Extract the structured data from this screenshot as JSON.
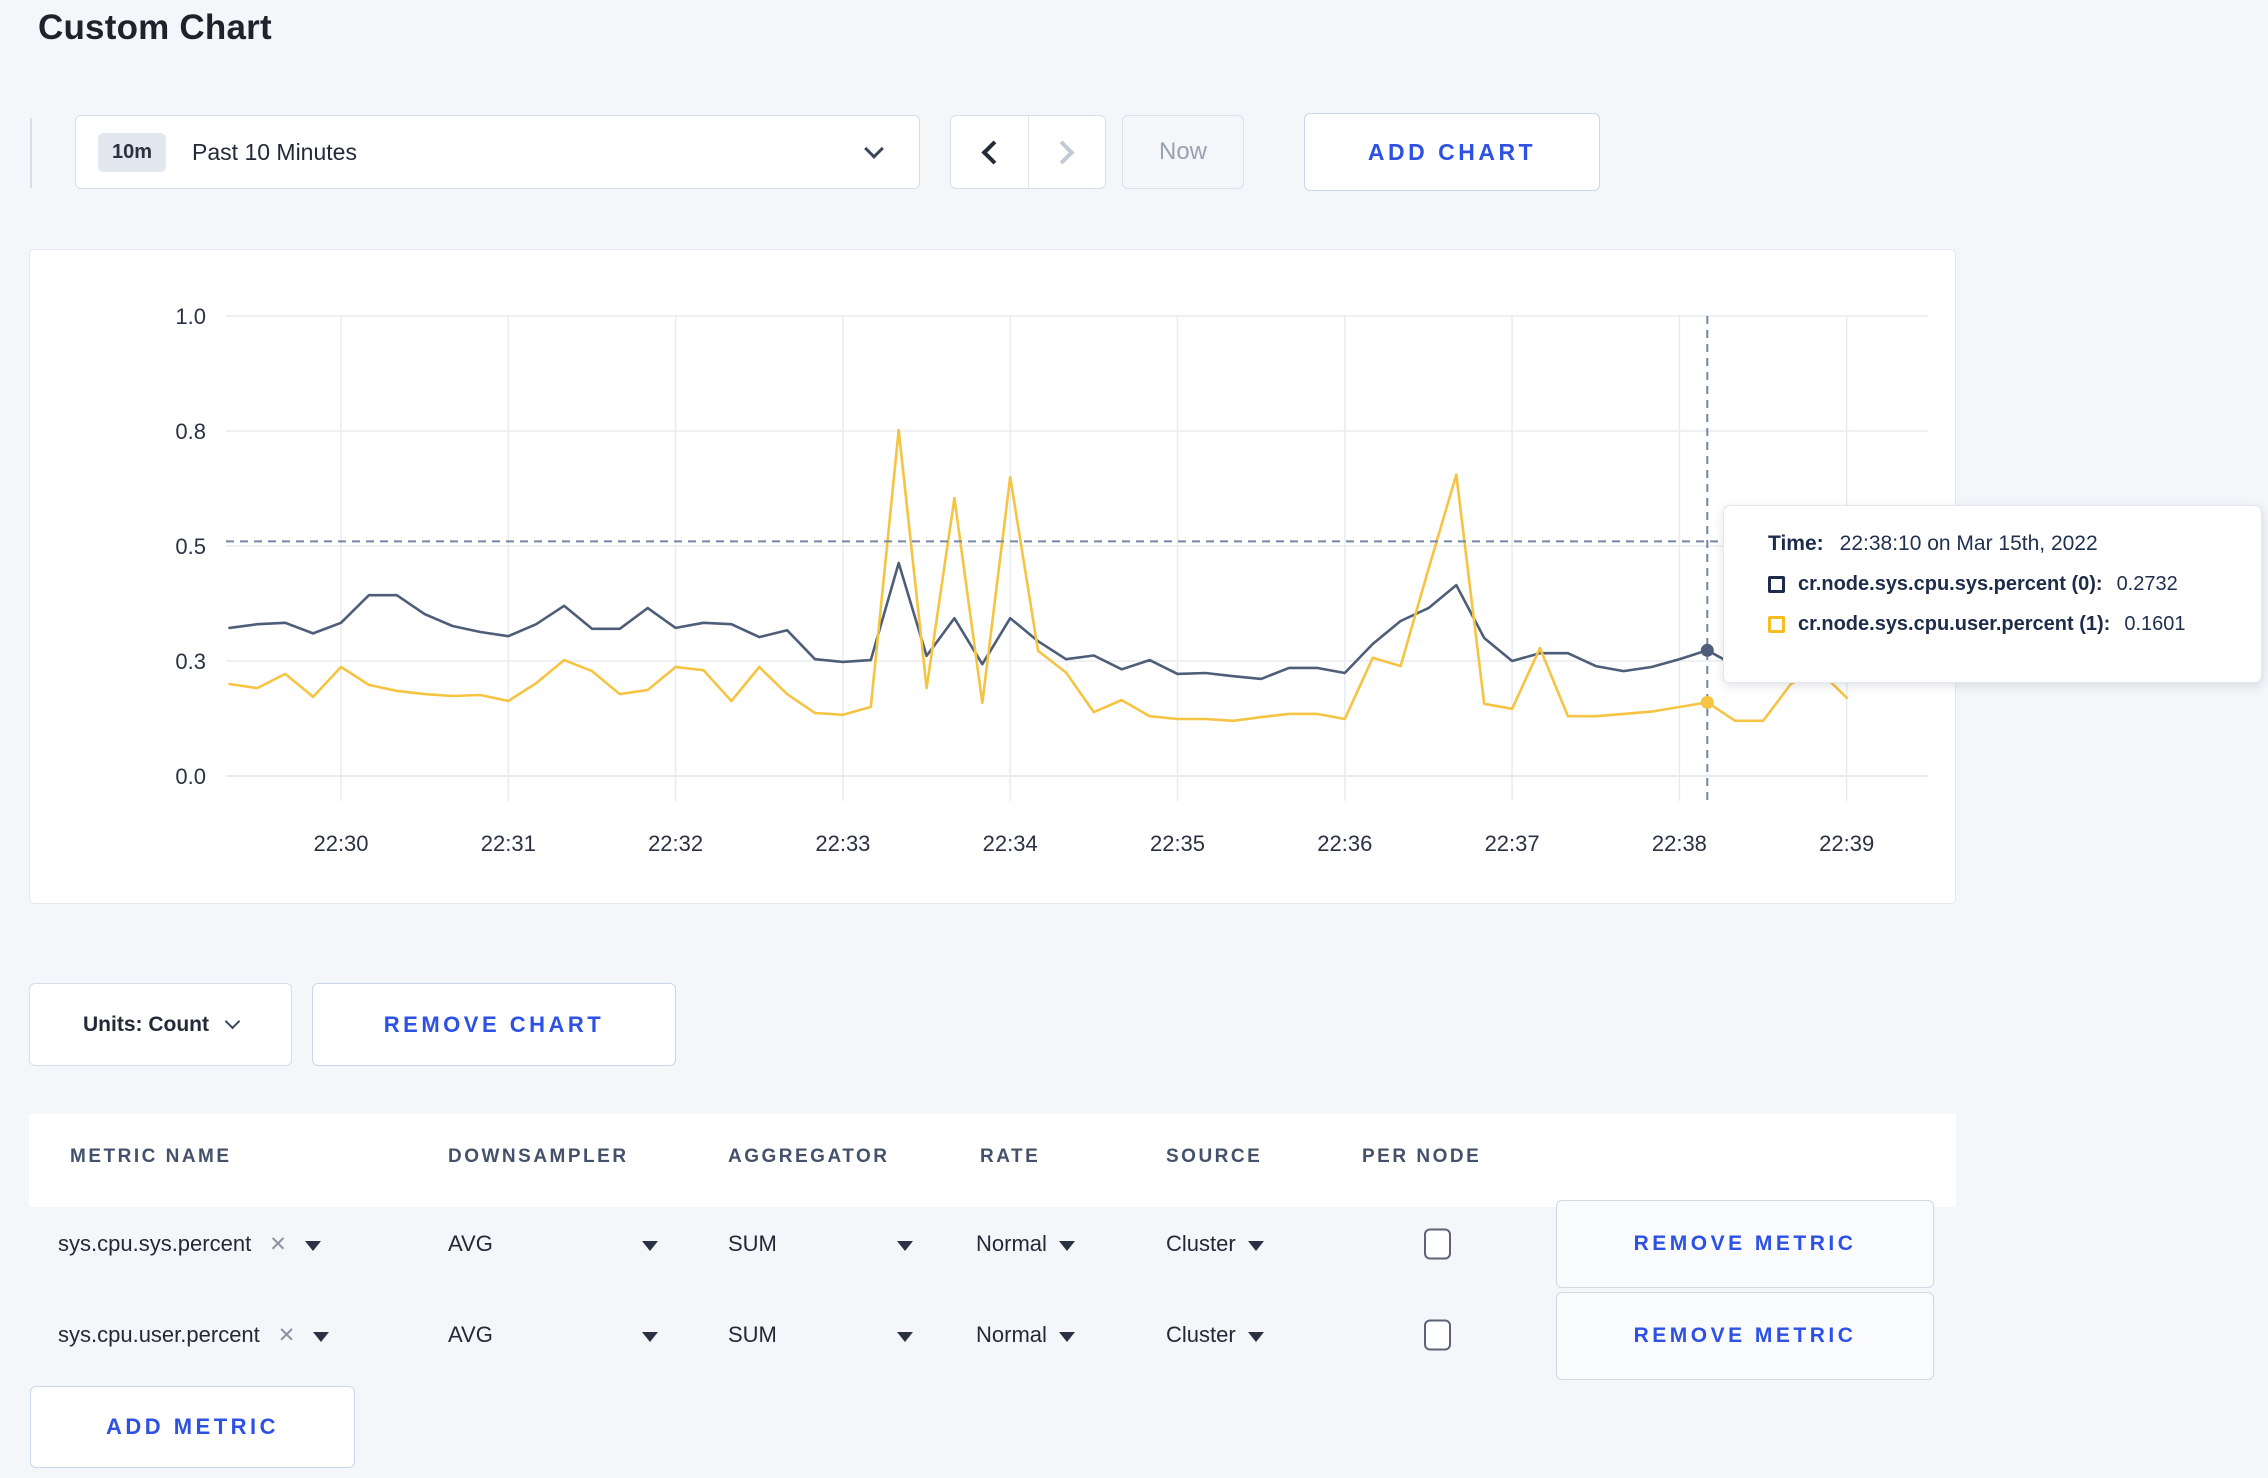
{
  "page": {
    "title": "Custom Chart"
  },
  "toolbar": {
    "time_window": {
      "badge": "10m",
      "label": "Past 10 Minutes"
    },
    "now_label": "Now",
    "add_chart_label": "ADD CHART"
  },
  "chart_data": {
    "type": "line",
    "title": "",
    "xlabel": "",
    "ylabel": "",
    "ylim": [
      0,
      1.0
    ],
    "grid": true,
    "x_ticks": [
      "22:30",
      "22:31",
      "22:32",
      "22:33",
      "22:34",
      "22:35",
      "22:36",
      "22:37",
      "22:38",
      "22:39"
    ],
    "y_tick_labels": [
      "0.0",
      "0.3",
      "0.5",
      "0.8",
      "1.0"
    ],
    "y_tick_values": [
      0,
      0.25,
      0.5,
      0.75,
      1.0
    ],
    "start_offset_seconds": -40,
    "step_seconds": 10,
    "series": [
      {
        "name": "cr.node.sys.cpu.sys.percent",
        "color": "#4e5d78",
        "values": [
          0.322,
          0.33,
          0.333,
          0.31,
          0.333,
          0.393,
          0.393,
          0.352,
          0.326,
          0.313,
          0.304,
          0.33,
          0.37,
          0.32,
          0.32,
          0.365,
          0.322,
          0.333,
          0.33,
          0.302,
          0.317,
          0.254,
          0.248,
          0.252,
          0.463,
          0.261,
          0.343,
          0.243,
          0.343,
          0.293,
          0.254,
          0.262,
          0.232,
          0.252,
          0.222,
          0.224,
          0.217,
          0.211,
          0.235,
          0.235,
          0.224,
          0.287,
          0.337,
          0.365,
          0.415,
          0.3,
          0.25,
          0.267,
          0.267,
          0.239,
          0.228,
          0.237,
          0.254,
          0.2732,
          0.24,
          0.23,
          0.235,
          0.228,
          0.24
        ]
      },
      {
        "name": "cr.node.sys.cpu.user.percent",
        "color": "#f6c443",
        "values": [
          0.2,
          0.191,
          0.222,
          0.172,
          0.237,
          0.198,
          0.185,
          0.178,
          0.174,
          0.176,
          0.163,
          0.202,
          0.252,
          0.228,
          0.178,
          0.187,
          0.237,
          0.23,
          0.163,
          0.237,
          0.178,
          0.137,
          0.133,
          0.15,
          0.752,
          0.191,
          0.604,
          0.159,
          0.65,
          0.272,
          0.225,
          0.139,
          0.165,
          0.13,
          0.124,
          0.124,
          0.12,
          0.128,
          0.135,
          0.135,
          0.124,
          0.257,
          0.239,
          0.45,
          0.655,
          0.157,
          0.146,
          0.278,
          0.13,
          0.13,
          0.135,
          0.14,
          0.15,
          0.1601,
          0.12,
          0.12,
          0.2,
          0.23,
          0.17
        ]
      }
    ],
    "hover": {
      "time": "22:38:10",
      "seconds_after_2230": 490,
      "crosshair_value": 0.51,
      "values": [
        0.2732,
        0.1601
      ]
    },
    "legend_position": "tooltip"
  },
  "tooltip": {
    "time_label": "Time:",
    "time_value": "22:38:10 on Mar 15th, 2022",
    "rows": [
      {
        "name": "cr.node.sys.cpu.sys.percent (0):",
        "value": "0.2732",
        "color": "#1c2b4a"
      },
      {
        "name": "cr.node.sys.cpu.user.percent (1):",
        "value": "0.1601",
        "color": "#f5bd1f"
      }
    ]
  },
  "chart_controls": {
    "units_label": "Units: Count",
    "remove_chart_label": "REMOVE CHART"
  },
  "metrics_table": {
    "headers": [
      "METRIC NAME",
      "DOWNSAMPLER",
      "AGGREGATOR",
      "RATE",
      "SOURCE",
      "PER NODE"
    ],
    "rows": [
      {
        "metric": "sys.cpu.sys.percent",
        "downsampler": "AVG",
        "aggregator": "SUM",
        "rate": "Normal",
        "source": "Cluster",
        "per_node_checked": false,
        "remove_label": "REMOVE METRIC"
      },
      {
        "metric": "sys.cpu.user.percent",
        "downsampler": "AVG",
        "aggregator": "SUM",
        "rate": "Normal",
        "source": "Cluster",
        "per_node_checked": false,
        "remove_label": "REMOVE METRIC"
      }
    ],
    "add_metric_label": "ADD METRIC"
  },
  "colors": {
    "accent_blue": "#2c51e3",
    "series_sys": "#4e5d78",
    "series_user": "#f6c443",
    "background": "#f4f6fa"
  }
}
